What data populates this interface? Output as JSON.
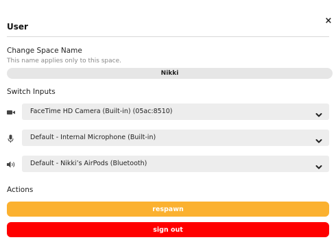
{
  "header": {
    "title": "User",
    "close_label": "×"
  },
  "space_name": {
    "label": "Change Space Name",
    "helper": "This name applies only to this space.",
    "value": "Nikki"
  },
  "inputs": {
    "label": "Switch Inputs",
    "camera": {
      "icon": "camera-icon",
      "value": "FaceTime HD Camera (Built-in) (05ac:8510)"
    },
    "microphone": {
      "icon": "microphone-icon",
      "value": "Default - Internal Microphone (Built-in)"
    },
    "speaker": {
      "icon": "speaker-icon",
      "value": "Default - Nikki’s AirPods (Bluetooth)"
    }
  },
  "actions": {
    "label": "Actions",
    "respawn_label": "respawn",
    "signout_label": "sign out"
  },
  "colors": {
    "respawn": "#fbb130",
    "signout": "#ff0000",
    "field_bg": "#ededed"
  }
}
